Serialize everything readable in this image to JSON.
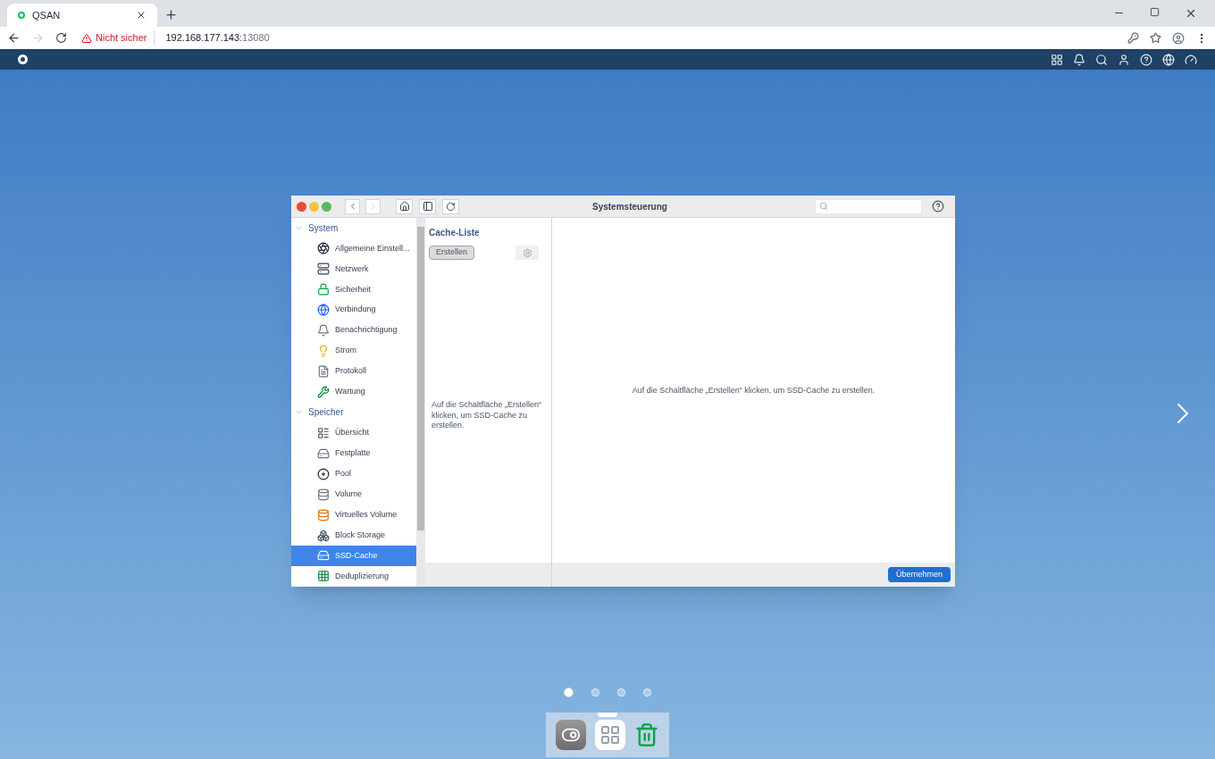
{
  "browser": {
    "tab": {
      "title": "QSAN",
      "selected": true
    },
    "security": "Nicht sicher",
    "url_host": "192.168.177.143",
    "url_port": ":13080"
  },
  "window": {
    "title": "Systemsteuerung"
  },
  "sidebar": [
    {
      "label": "System",
      "expanded": true,
      "items": [
        {
          "label": "Allgemeine Einstell...",
          "selected": false
        },
        {
          "label": "Netzwerk",
          "selected": false
        },
        {
          "label": "Sicherheit",
          "selected": false
        },
        {
          "label": "Verbindung",
          "selected": false
        },
        {
          "label": "Benachrichtigung",
          "selected": false
        },
        {
          "label": "Strom",
          "selected": false
        },
        {
          "label": "Protokoll",
          "selected": false
        },
        {
          "label": "Wartung",
          "selected": false
        }
      ]
    },
    {
      "label": "Speicher",
      "expanded": true,
      "items": [
        {
          "label": "Übersicht",
          "selected": false
        },
        {
          "label": "Festplatte",
          "selected": false
        },
        {
          "label": "Pool",
          "selected": false
        },
        {
          "label": "Volume",
          "selected": false
        },
        {
          "label": "Virtuelles Volume",
          "selected": false
        },
        {
          "label": "Block Storage",
          "selected": false
        },
        {
          "label": "SSD-Cache",
          "selected": true
        },
        {
          "label": "Deduplizierung",
          "selected": false
        }
      ]
    }
  ],
  "cache_list": {
    "title": "Cache-Liste",
    "create_button": "Erstellen",
    "hint": "Auf die Schaltfläche „Erstellen“ klicken, um SSD-Cache zu erstellen."
  },
  "main_message": "Auf die Schaltfläche „Erstellen“ klicken, um SSD-Cache zu erstellen.",
  "apply_button": "Übernehmen",
  "pager": [
    {
      "selected": true
    },
    {
      "selected": false
    },
    {
      "selected": false
    },
    {
      "selected": false
    }
  ]
}
